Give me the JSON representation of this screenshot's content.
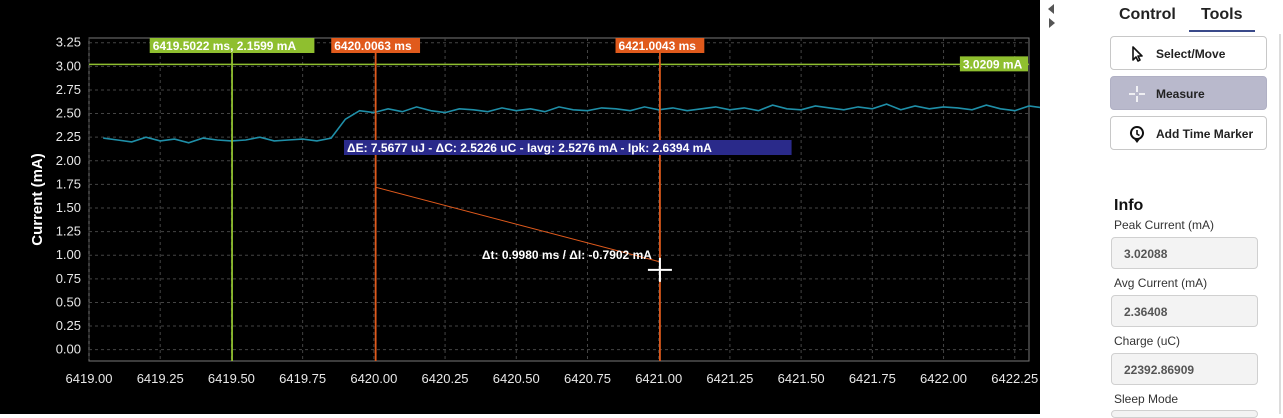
{
  "chart_data": {
    "type": "line",
    "ylabel": "Current (mA)",
    "xlabel": "",
    "xlim": [
      6419.0,
      6422.3
    ],
    "ylim": [
      -0.12,
      3.3
    ],
    "x_ticks": [
      "6419.00",
      "6419.25",
      "6419.50",
      "6419.75",
      "6420.00",
      "6420.25",
      "6420.50",
      "6420.75",
      "6421.00",
      "6421.25",
      "6421.50",
      "6421.75",
      "6422.00",
      "6422.25"
    ],
    "y_ticks": [
      "3.25",
      "3.00",
      "2.75",
      "2.50",
      "2.25",
      "2.00",
      "1.75",
      "1.50",
      "1.25",
      "1.00",
      "0.75",
      "0.50",
      "0.25",
      "0.00"
    ],
    "series": [
      {
        "x_start": 6419.05,
        "x_step": 0.05,
        "values": [
          2.24,
          2.22,
          2.2,
          2.25,
          2.21,
          2.23,
          2.19,
          2.24,
          2.22,
          2.21,
          2.22,
          2.25,
          2.21,
          2.22,
          2.23,
          2.21,
          2.24,
          2.44,
          2.53,
          2.51,
          2.55,
          2.52,
          2.57,
          2.53,
          2.51,
          2.55,
          2.54,
          2.52,
          2.56,
          2.53,
          2.55,
          2.52,
          2.57,
          2.54,
          2.53,
          2.56,
          2.55,
          2.53,
          2.57,
          2.54,
          2.56,
          2.53,
          2.55,
          2.57,
          2.54,
          2.56,
          2.53,
          2.59,
          2.55,
          2.54,
          2.58,
          2.56,
          2.54,
          2.57,
          2.55,
          2.6,
          2.54,
          2.58,
          2.55,
          2.57,
          2.56,
          2.54,
          2.59,
          2.55,
          2.53,
          2.58,
          2.56,
          2.54,
          2.57,
          2.55
        ]
      }
    ],
    "cursor_lines": [
      {
        "x": 6419.5022,
        "label": "6419.5022 ms, 2.1599 mA",
        "color": "#8fbf2f"
      },
      {
        "x": 6420.0063,
        "label": "6420.0063 ms",
        "color": "#e05a1c"
      },
      {
        "x": 6421.0043,
        "label": "6421.0043 ms",
        "color": "#e05a1c"
      }
    ],
    "h_marker": {
      "y": 3.0209,
      "label": "3.0209 mA",
      "color": "#8fbf2f"
    },
    "measure_info": "ΔE: 7.5677 uJ - ΔC: 2.5226 uC - Iavg: 2.5276 mA - Ipk: 2.6394 mA",
    "measure_line": {
      "x1": 6420.0063,
      "y1": 1.72,
      "x2": 6421.0043,
      "y2": 0.93
    },
    "delta_label": "Δt: 0.9980 ms / ΔI: -0.7902 mA",
    "grid": true,
    "colors": {
      "background": "#000000",
      "line": "#1f8fa8",
      "grid": "#444444",
      "text": "#e8e8e8",
      "box": "#2a2a8a"
    }
  },
  "tabs": {
    "control": "Control",
    "tools": "Tools"
  },
  "tools": {
    "select_label": "Select/Move",
    "measure_label": "Measure",
    "marker_label": "Add Time Marker"
  },
  "info": {
    "heading": "Info",
    "peak_label": "Peak Current (mA)",
    "peak_value": "3.02088",
    "avg_label": "Avg Current (mA)",
    "avg_value": "2.36408",
    "charge_label": "Charge (uC)",
    "charge_value": "22392.86909",
    "sleep_label": "Sleep Mode"
  }
}
